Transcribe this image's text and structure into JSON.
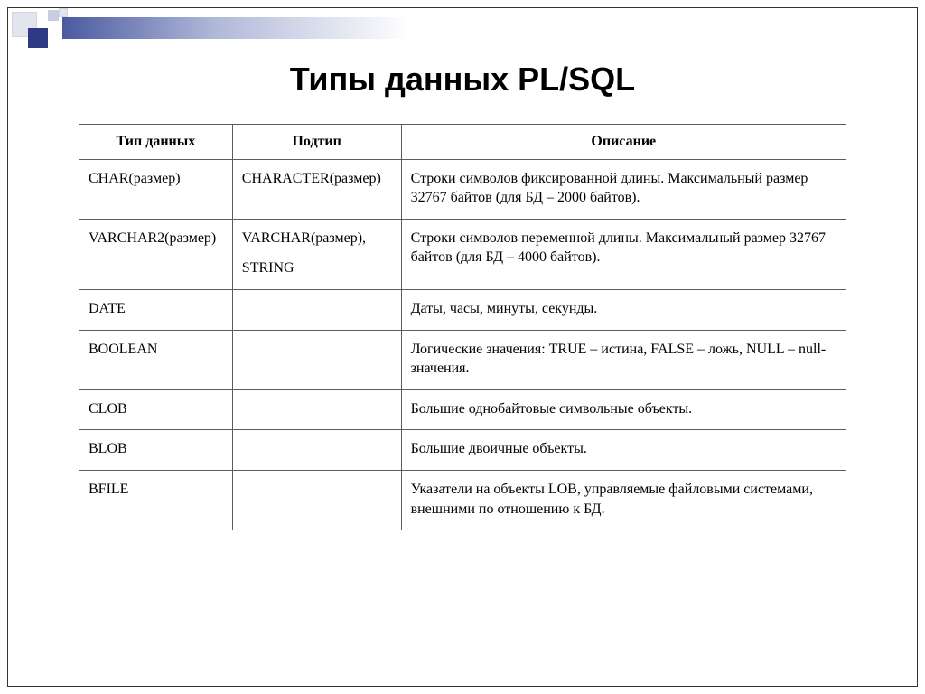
{
  "title": "Типы данных PL/SQL",
  "headers": {
    "col1": "Тип данных",
    "col2": "Подтип",
    "col3": "Описание"
  },
  "rows": [
    {
      "type": "CHAR(размер)",
      "subtype_a": "CHARACTER(размер)",
      "subtype_b": "",
      "desc": "Строки символов фиксированной длины. Максимальный размер 32767 байтов (для БД – 2000 байтов)."
    },
    {
      "type": "VARCHAR2(размер)",
      "subtype_a": "VARCHAR(размер),",
      "subtype_b": "STRING",
      "desc": "Строки символов переменной длины. Максимальный размер 32767 байтов (для БД – 4000 байтов)."
    },
    {
      "type": "DATE",
      "subtype_a": "",
      "subtype_b": "",
      "desc": "Даты, часы, минуты, секунды."
    },
    {
      "type": "BOOLEAN",
      "subtype_a": "",
      "subtype_b": "",
      "desc": "Логические значения: TRUE – истина, FALSE – ложь, NULL – null-значения."
    },
    {
      "type": "CLOB",
      "subtype_a": "",
      "subtype_b": "",
      "desc": "Большие однобайтовые символьные объекты."
    },
    {
      "type": "BLOB",
      "subtype_a": "",
      "subtype_b": "",
      "desc": "Большие двоичные объекты."
    },
    {
      "type": "BFILE",
      "subtype_a": "",
      "subtype_b": "",
      "desc": "Указатели на объекты LOB, управляемые файловыми системами, внешними по отношению к БД."
    }
  ]
}
